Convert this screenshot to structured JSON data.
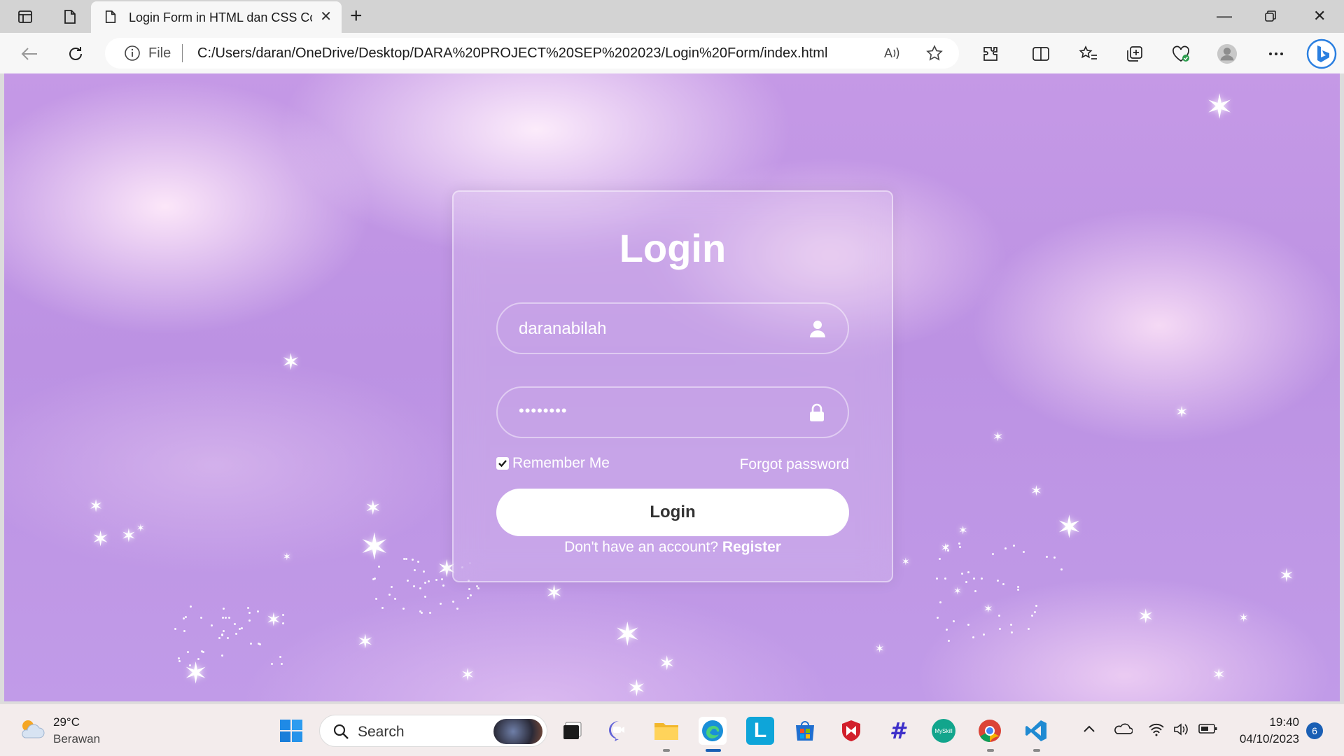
{
  "browser": {
    "tab_title": "Login Form in HTML dan CSS Co",
    "url_scheme": "File",
    "url": "C:/Users/daran/OneDrive/Desktop/DARA%20PROJECT%20SEP%202023/Login%20Form/index.html",
    "icons": [
      "sidebar-icon",
      "tab-actions-icon",
      "page-icon",
      "close-icon",
      "new-tab-icon",
      "minimize-icon",
      "restore-icon",
      "close-window-icon",
      "back-icon",
      "refresh-icon",
      "info-icon",
      "read-aloud-icon",
      "favorite-icon",
      "extensions-icon",
      "split-screen-icon",
      "favorites-icon",
      "collections-icon",
      "browser-essentials-icon",
      "profile-icon",
      "more-icon",
      "bing-icon"
    ]
  },
  "login": {
    "title": "Login",
    "username_value": "daranabilah",
    "password_mask": "••••••••",
    "remember_label": "Remember Me",
    "remember_checked": true,
    "forgot_label": "Forgot password",
    "button_label": "Login",
    "register_prompt": "Don't have an account?",
    "register_link": "Register"
  },
  "taskbar": {
    "weather_temp": "29°C",
    "weather_desc": "Berawan",
    "search_label": "Search",
    "time": "19:40",
    "date": "04/10/2023",
    "notification_count": "6"
  },
  "colors": {
    "background": "#c19be8",
    "accent": "#ffffff",
    "button_text": "#333333"
  }
}
